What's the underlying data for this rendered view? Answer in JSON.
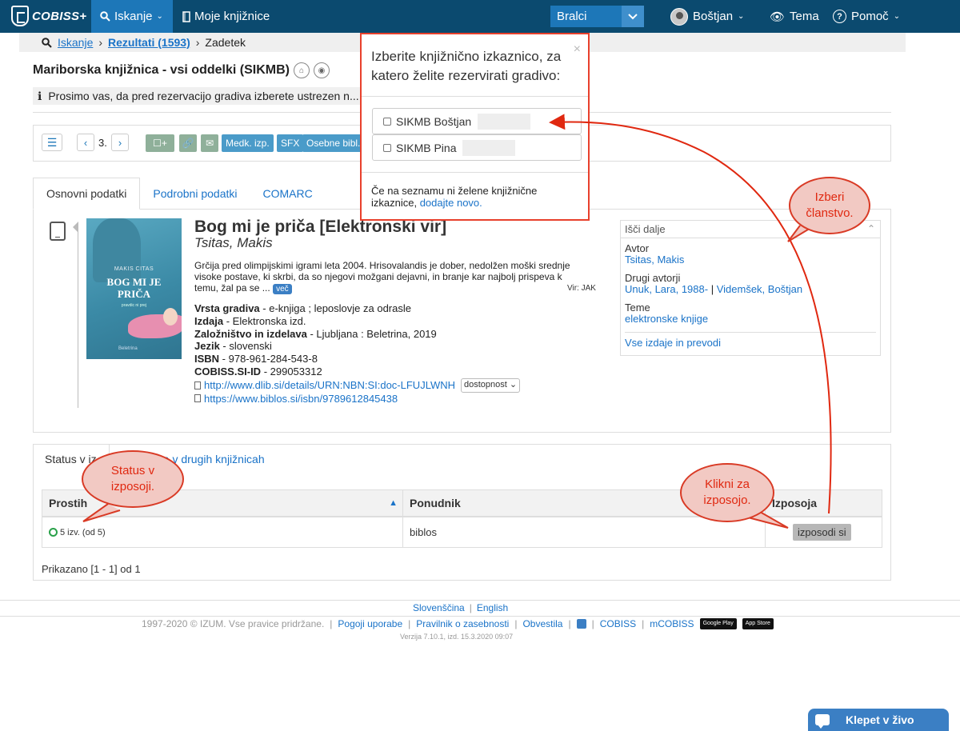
{
  "topbar": {
    "logo": "COBISS+",
    "search_tab": "Iskanje",
    "my_libraries": "Moje knjižnice",
    "role_select": "Bralci",
    "user": "Boštjan",
    "theme": "Tema",
    "help": "Pomoč"
  },
  "breadcrumb": {
    "search": "Iskanje",
    "results": "Rezultati (1593)",
    "record": "Zadetek"
  },
  "library_title": "Mariborska knjižnica - vsi oddelki (SIKMB)",
  "notice": "Prosimo vas, da pred rezervacijo gradiva izberete ustrezen n... Prik",
  "toolbar": {
    "record_no": "3.",
    "buttons": [
      "Medk. izp.",
      "SFX",
      "Osebne bibl."
    ]
  },
  "tabs": [
    "Osnovni podatki",
    "Podrobni podatki",
    "COMARC"
  ],
  "book": {
    "cover_author": "MAKIS CITAS",
    "cover_title_1": "BOG MI JE",
    "cover_title_2": "PRIČA",
    "cover_subtitle": "pravdic ni prej",
    "cover_publisher": "Beletrina",
    "title": "Bog mi je priča [Elektronski vir]",
    "author": "Tsitas, Makis",
    "abstract": "Grčija pred olimpijskimi igrami leta 2004. Hrisovalandis je dober, nedolžen moški srednje visoke postave, ki skrbi, da so njegovi možgani dejavni, in branje kar najbolj prispeva k temu, žal pa se ...",
    "more": "več",
    "source": "Vir: JAK",
    "fields": [
      {
        "label": "Vrsta gradiva",
        "value": " - e-knjiga ; leposlovje za odrasle"
      },
      {
        "label": "Izdaja",
        "value": " - Elektronska izd."
      },
      {
        "label": "Založništvo in izdelava",
        "value": " - Ljubljana : Beletrina, 2019"
      },
      {
        "label": "Jezik",
        "value": " - slovenski"
      },
      {
        "label": "ISBN",
        "value": " - 978-961-284-543-8"
      },
      {
        "label": "COBISS.SI-ID",
        "value": " - 299053312"
      }
    ],
    "links": [
      "http://www.dlib.si/details/URN:NBN:SI:doc-LFUJLWNH",
      "https://www.biblos.si/isbn/9789612845438"
    ],
    "availability_select": "dostopnost"
  },
  "isci": {
    "header": "Išči dalje",
    "author_label": "Avtor",
    "author": "Tsitas, Makis",
    "other_label": "Drugi avtorji",
    "other_1": "Unuk, Lara, 1988-",
    "other_sep": "|",
    "other_2": "Videmšek, Boštjan",
    "topics_label": "Teme",
    "topic": "elektronske knjige",
    "all_editions": "Vse izdaje in prevodi"
  },
  "status": {
    "tab1": "Status v iz",
    "tab2": "ga v drugih knjižnicah",
    "columns": [
      "Prostih",
      "Ponudnik",
      "Izposoja"
    ],
    "row": {
      "available": "5 izv. (od 5)",
      "provider": "biblos",
      "action": "izposodi si"
    },
    "shown": "Prikazano [1 - 1] od 1"
  },
  "popup": {
    "question": "Izberite knjižnično izkaznico, za katero želite rezervirati gradivo:",
    "cards": [
      "SIKMB Boštjan",
      "SIKMB Pina"
    ],
    "missing": "Če na seznamu ni želene knjižnične izkaznice, ",
    "add_new": "dodajte novo."
  },
  "callouts": {
    "membership": "Izberi članstvo.",
    "status": "Status v izposoji.",
    "borrow": "Klikni za izposojo."
  },
  "footer": {
    "lang1": "Slovenščina",
    "lang2": "English",
    "copyright": "1997-2020 © IZUM. Vse pravice pridržane.",
    "links": [
      "Pogoji uporabe",
      "Pravilnik o zasebnosti",
      "Obvestila",
      "COBISS",
      "mCOBISS"
    ],
    "store1": "Google Play",
    "store2": "App Store",
    "version": "Verzija 7.10.1, izd. 15.3.2020 09:07"
  },
  "chat": "Klepet v živo",
  "colors": {
    "topbar": "#0b4a6f",
    "accent": "#1d77b8",
    "callout": "#d93a25"
  }
}
